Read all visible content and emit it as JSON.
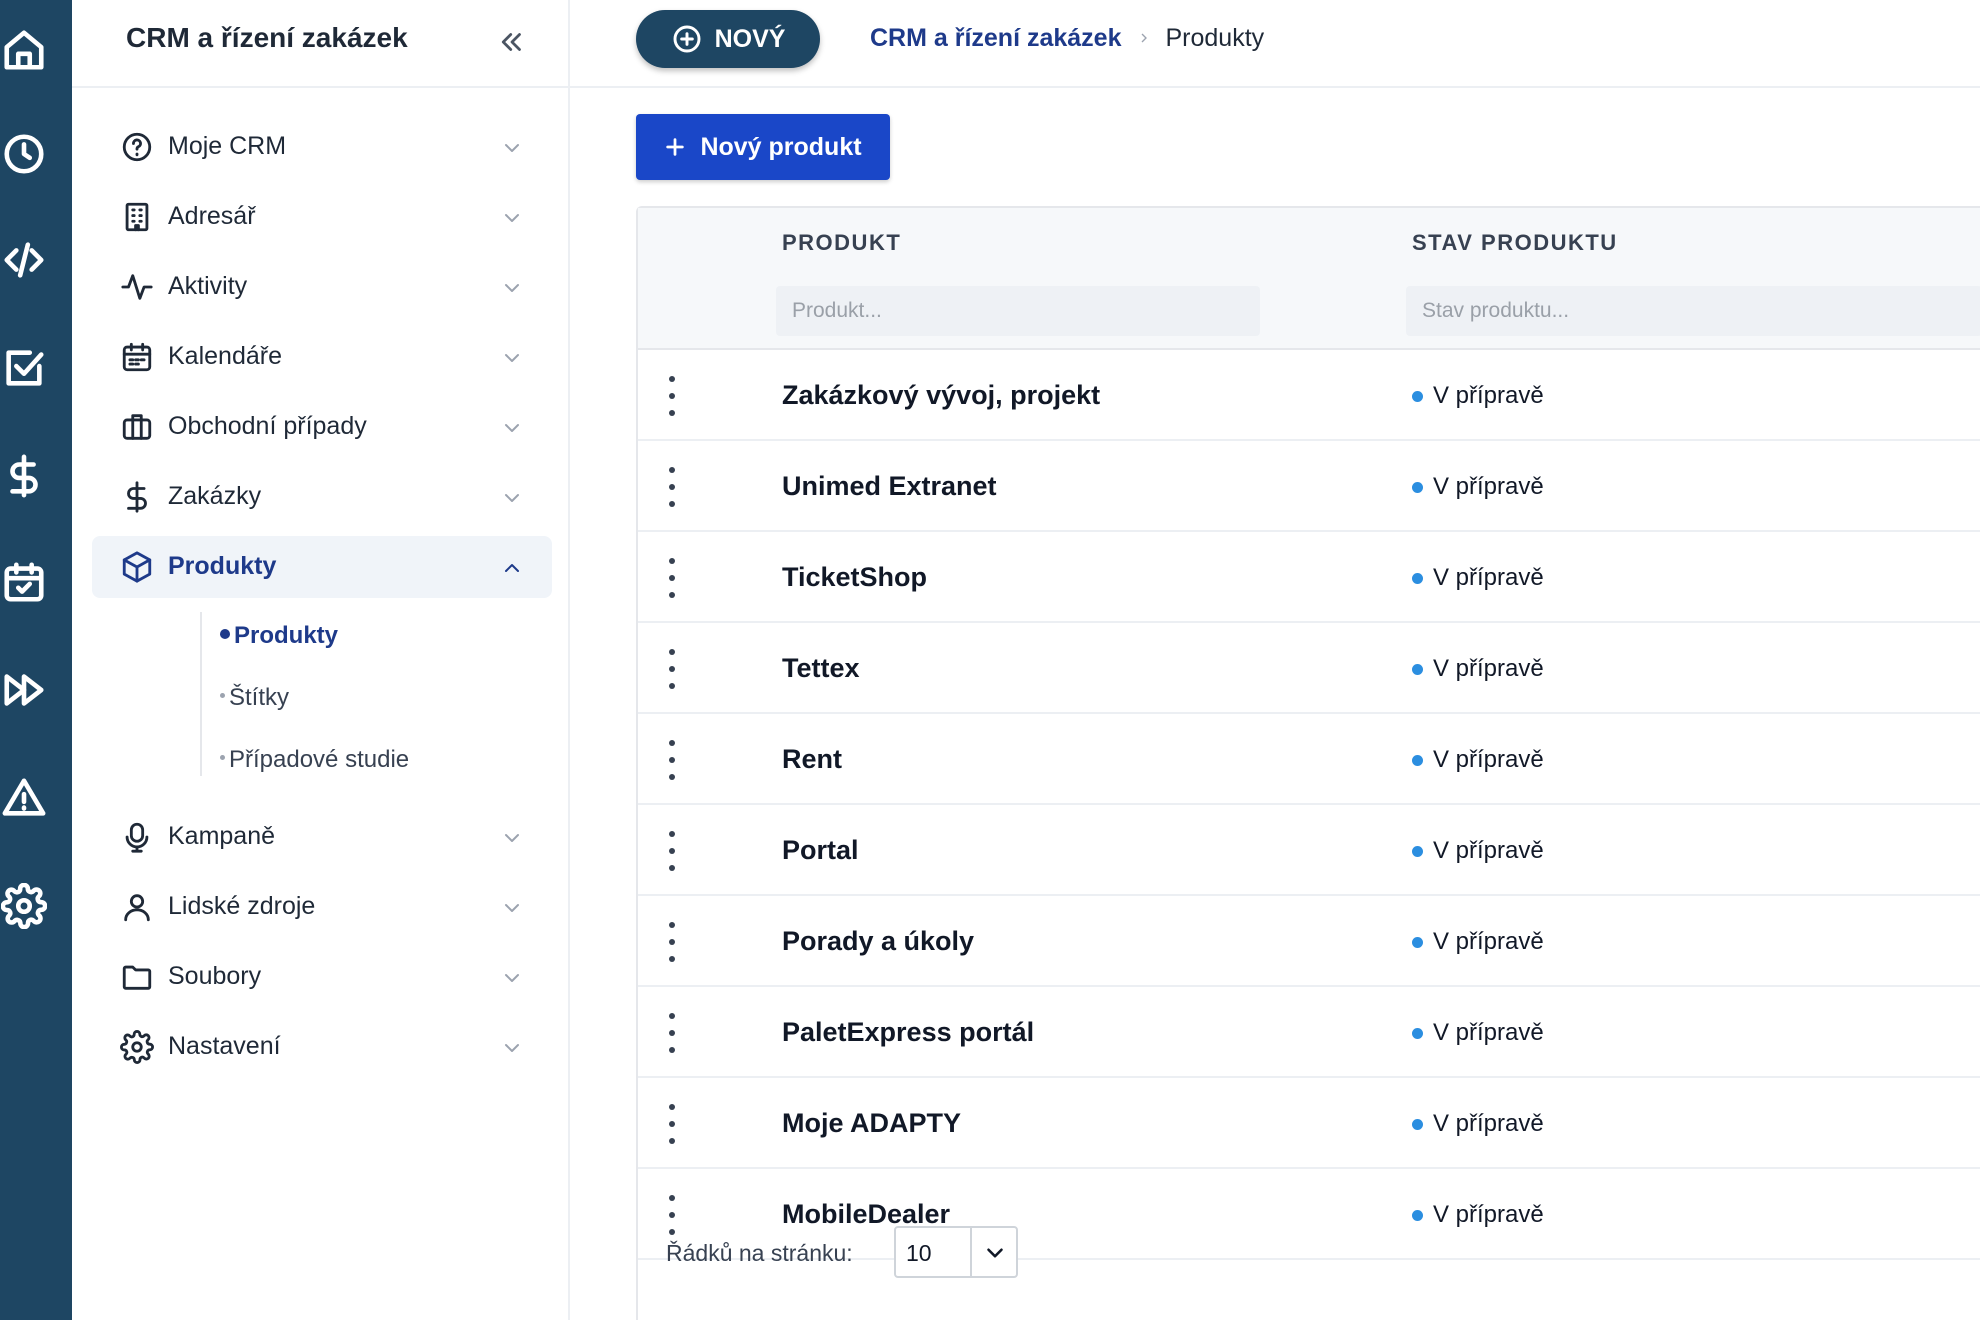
{
  "rail": {
    "icons": [
      "home-icon",
      "clock-icon",
      "code-icon",
      "checkbox-icon",
      "dollar-icon",
      "calendar-check-icon",
      "fast-forward-icon",
      "warning-icon",
      "gear-icon"
    ],
    "color": "#1e4663"
  },
  "sidebar": {
    "title": "CRM a řízení zakázek",
    "items": [
      {
        "label": "Moje CRM",
        "icon": "help-circle-icon"
      },
      {
        "label": "Adresář",
        "icon": "building-icon"
      },
      {
        "label": "Aktivity",
        "icon": "activity-icon"
      },
      {
        "label": "Kalendáře",
        "icon": "calendar-icon"
      },
      {
        "label": "Obchodní případy",
        "icon": "briefcase-icon"
      },
      {
        "label": "Zakázky",
        "icon": "dollar-icon"
      },
      {
        "label": "Produkty",
        "icon": "box-icon",
        "active": true
      },
      {
        "label": "Kampaně",
        "icon": "microphone-icon"
      },
      {
        "label": "Lidské zdroje",
        "icon": "user-icon"
      },
      {
        "label": "Soubory",
        "icon": "folder-icon"
      },
      {
        "label": "Nastavení",
        "icon": "gear-icon"
      }
    ],
    "subitems": [
      {
        "label": "Produkty",
        "active": true
      },
      {
        "label": "Štítky"
      },
      {
        "label": "Případové studie"
      }
    ]
  },
  "topbar": {
    "new_label": "NOVÝ",
    "breadcrumb": {
      "parent": "CRM a řízení zakázek",
      "current": "Produkty"
    }
  },
  "actions": {
    "new_product_label": "Nový produkt"
  },
  "table": {
    "columns": {
      "product": "PRODUKT",
      "status": "STAV PRODUKTU"
    },
    "filters": {
      "product_placeholder": "Produkt...",
      "status_placeholder": "Stav produktu..."
    },
    "rows": [
      {
        "name": "Zakázkový vývoj, projekt",
        "status": "V přípravě"
      },
      {
        "name": "Unimed Extranet",
        "status": "V přípravě"
      },
      {
        "name": "TicketShop",
        "status": "V přípravě"
      },
      {
        "name": "Tettex",
        "status": "V přípravě"
      },
      {
        "name": "Rent",
        "status": "V přípravě"
      },
      {
        "name": "Portal",
        "status": "V přípravě"
      },
      {
        "name": "Porady a úkoly",
        "status": "V přípravě"
      },
      {
        "name": "PaletExpress portál",
        "status": "V přípravě"
      },
      {
        "name": "Moje ADAPTY",
        "status": "V přípravě"
      },
      {
        "name": "MobileDealer",
        "status": "V přípravě"
      }
    ],
    "status_color": "#2b8ee0",
    "pager": {
      "label": "Řádků na stránku:",
      "value": "10"
    }
  }
}
